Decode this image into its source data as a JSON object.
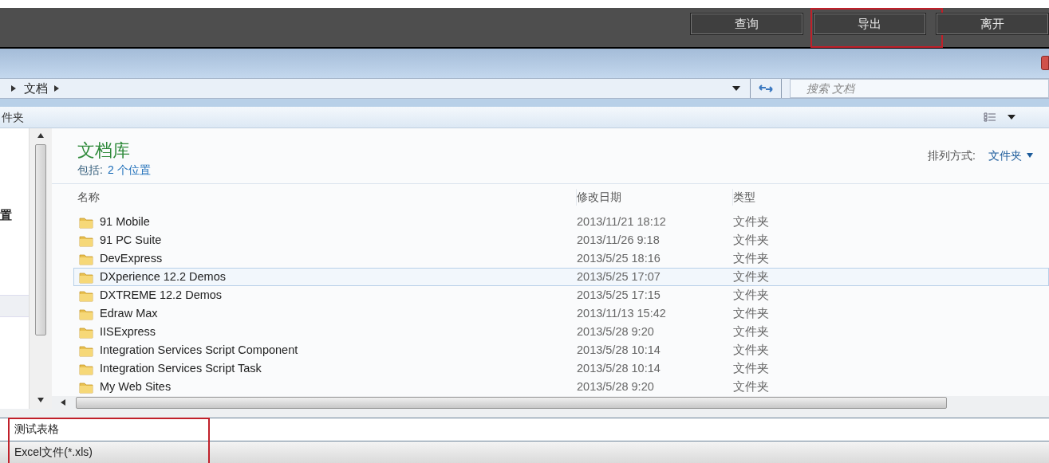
{
  "top_buttons": [
    {
      "label": "查询",
      "highlighted": false
    },
    {
      "label": "导出",
      "highlighted": true
    },
    {
      "label": "离开",
      "highlighted": false
    }
  ],
  "breadcrumb": [
    "文档"
  ],
  "search": {
    "placeholder": "搜索 文档"
  },
  "toolbar": {
    "label": "件夹"
  },
  "nav_pane": {
    "label": "置"
  },
  "library": {
    "title": "文档库",
    "includes_label": "包括:",
    "includes_link": "2 个位置",
    "arrange_label": "排列方式:",
    "arrange_value": "文件夹"
  },
  "table": {
    "columns": [
      "名称",
      "修改日期",
      "类型"
    ],
    "rows": [
      {
        "name": "91 Mobile",
        "date": "2013/11/21 18:12",
        "type": "文件夹",
        "selected": false
      },
      {
        "name": "91 PC Suite",
        "date": "2013/11/26 9:18",
        "type": "文件夹",
        "selected": false
      },
      {
        "name": "DevExpress",
        "date": "2013/5/25 18:16",
        "type": "文件夹",
        "selected": false
      },
      {
        "name": "DXperience 12.2 Demos",
        "date": "2013/5/25 17:07",
        "type": "文件夹",
        "selected": true
      },
      {
        "name": "DXTREME 12.2 Demos",
        "date": "2013/5/25 17:15",
        "type": "文件夹",
        "selected": false
      },
      {
        "name": "Edraw Max",
        "date": "2013/11/13 15:42",
        "type": "文件夹",
        "selected": false
      },
      {
        "name": "IISExpress",
        "date": "2013/5/28 9:20",
        "type": "文件夹",
        "selected": false
      },
      {
        "name": "Integration Services Script Component",
        "date": "2013/5/28 10:14",
        "type": "文件夹",
        "selected": false
      },
      {
        "name": "Integration Services Script Task",
        "date": "2013/5/28 10:14",
        "type": "文件夹",
        "selected": false
      },
      {
        "name": "My Web Sites",
        "date": "2013/5/28 9:20",
        "type": "文件夹",
        "selected": false
      }
    ]
  },
  "save": {
    "file_name": "测试表格",
    "file_type": "Excel文件(*.xls)",
    "highlighted": true
  }
}
